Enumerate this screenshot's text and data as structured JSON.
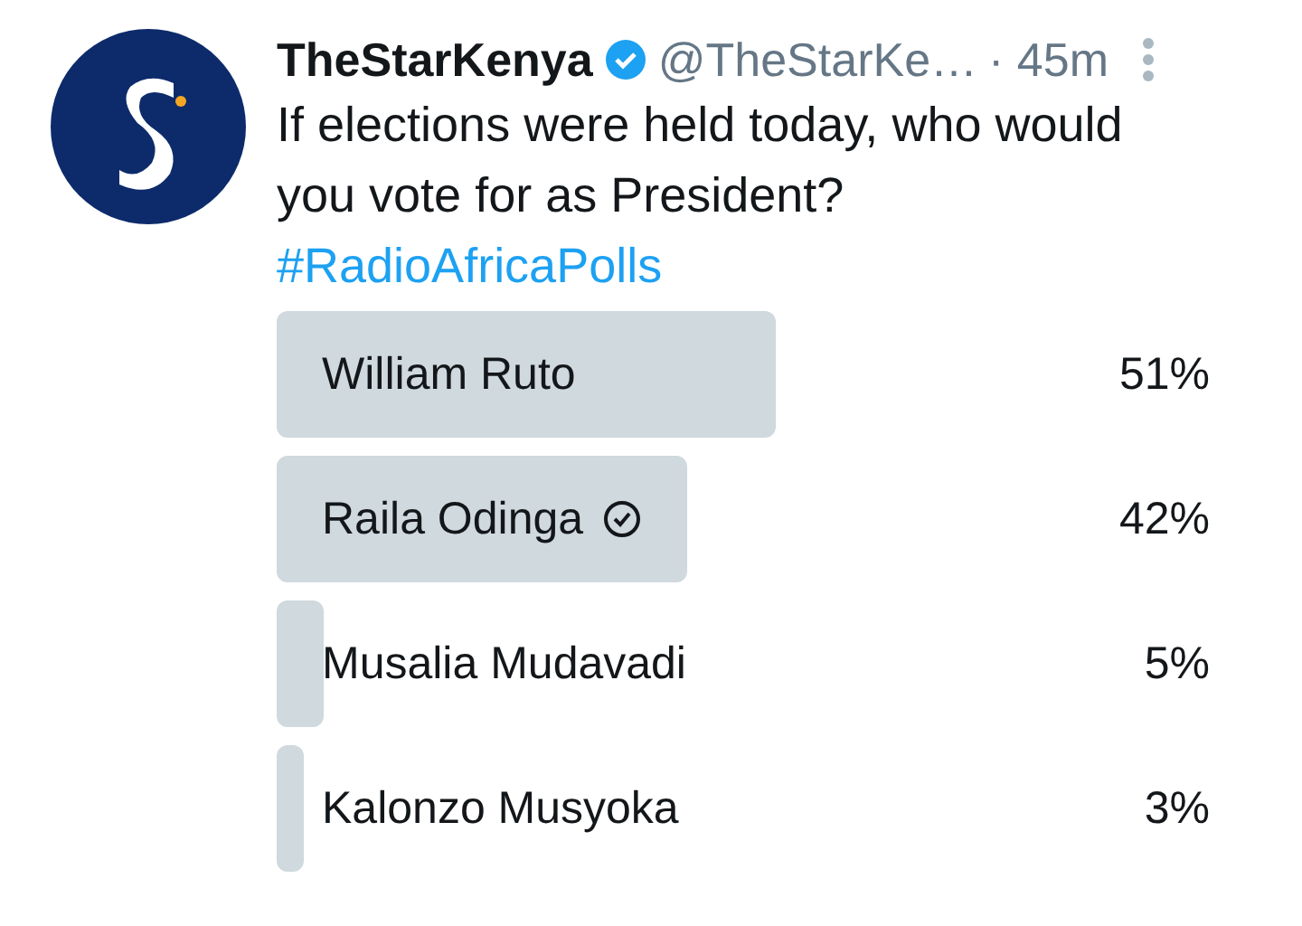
{
  "tweet": {
    "name": "TheStarKenya",
    "verified": true,
    "handle": "@TheStarKe…",
    "time": "· 45m",
    "text": "If elections were held today, who would you vote for as President?",
    "hashtag": "#RadioAfricaPolls"
  },
  "poll": {
    "options": [
      {
        "label": "William Ruto",
        "percent": "51%",
        "level": 0.535,
        "selected": false
      },
      {
        "label": "Raila Odinga",
        "percent": "42%",
        "level": 0.44,
        "selected": true
      },
      {
        "label": "Musalia Mudavadi",
        "percent": "5%",
        "level": 0.05,
        "selected": false
      },
      {
        "label": "Kalonzo Musyoka",
        "percent": "3%",
        "level": 0.03,
        "selected": false
      }
    ]
  }
}
